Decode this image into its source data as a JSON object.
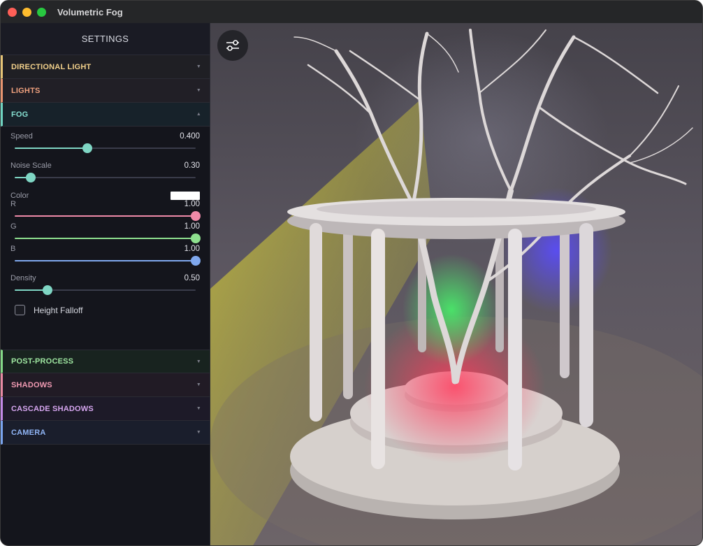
{
  "window": {
    "title": "Volumetric Fog"
  },
  "sidebar": {
    "header": "SETTINGS",
    "sections": {
      "directional_light": "DIRECTIONAL LIGHT",
      "lights": "LIGHTS",
      "fog": "FOG",
      "post_process": "POST-PROCESS",
      "shadows": "SHADOWS",
      "cascade_shadows": "CASCADE SHADOWS",
      "camera": "CAMERA"
    },
    "fog": {
      "speed": {
        "label": "Speed",
        "value": "0.400",
        "fraction": 0.4
      },
      "noise_scale": {
        "label": "Noise Scale",
        "value": "0.30",
        "fraction": 0.09
      },
      "color": {
        "label": "Color",
        "swatch": "#ffffff"
      },
      "r": {
        "label": "R",
        "value": "1.00",
        "fraction": 1.0,
        "color": "#ee8aa8"
      },
      "g": {
        "label": "G",
        "value": "1.00",
        "fraction": 1.0,
        "color": "#8ee08f"
      },
      "b": {
        "label": "B",
        "value": "1.00",
        "fraction": 1.0,
        "color": "#7fa8ee"
      },
      "density": {
        "label": "Density",
        "value": "0.50",
        "fraction": 0.18
      },
      "height_falloff": {
        "label": "Height Falloff",
        "checked": false
      }
    }
  },
  "viewport": {
    "settings_button_icon": "sliders-icon",
    "scene": "gazebo-with-tree"
  },
  "colors": {
    "accent_teal": "#7fd6c4",
    "directional_light": "#e6c477",
    "lights": "#e89470",
    "fog": "#6fd3c0",
    "post_process": "#84d987",
    "shadows": "#e88aa3",
    "cascade_shadows": "#c28ae6",
    "camera": "#7aa4ee"
  }
}
